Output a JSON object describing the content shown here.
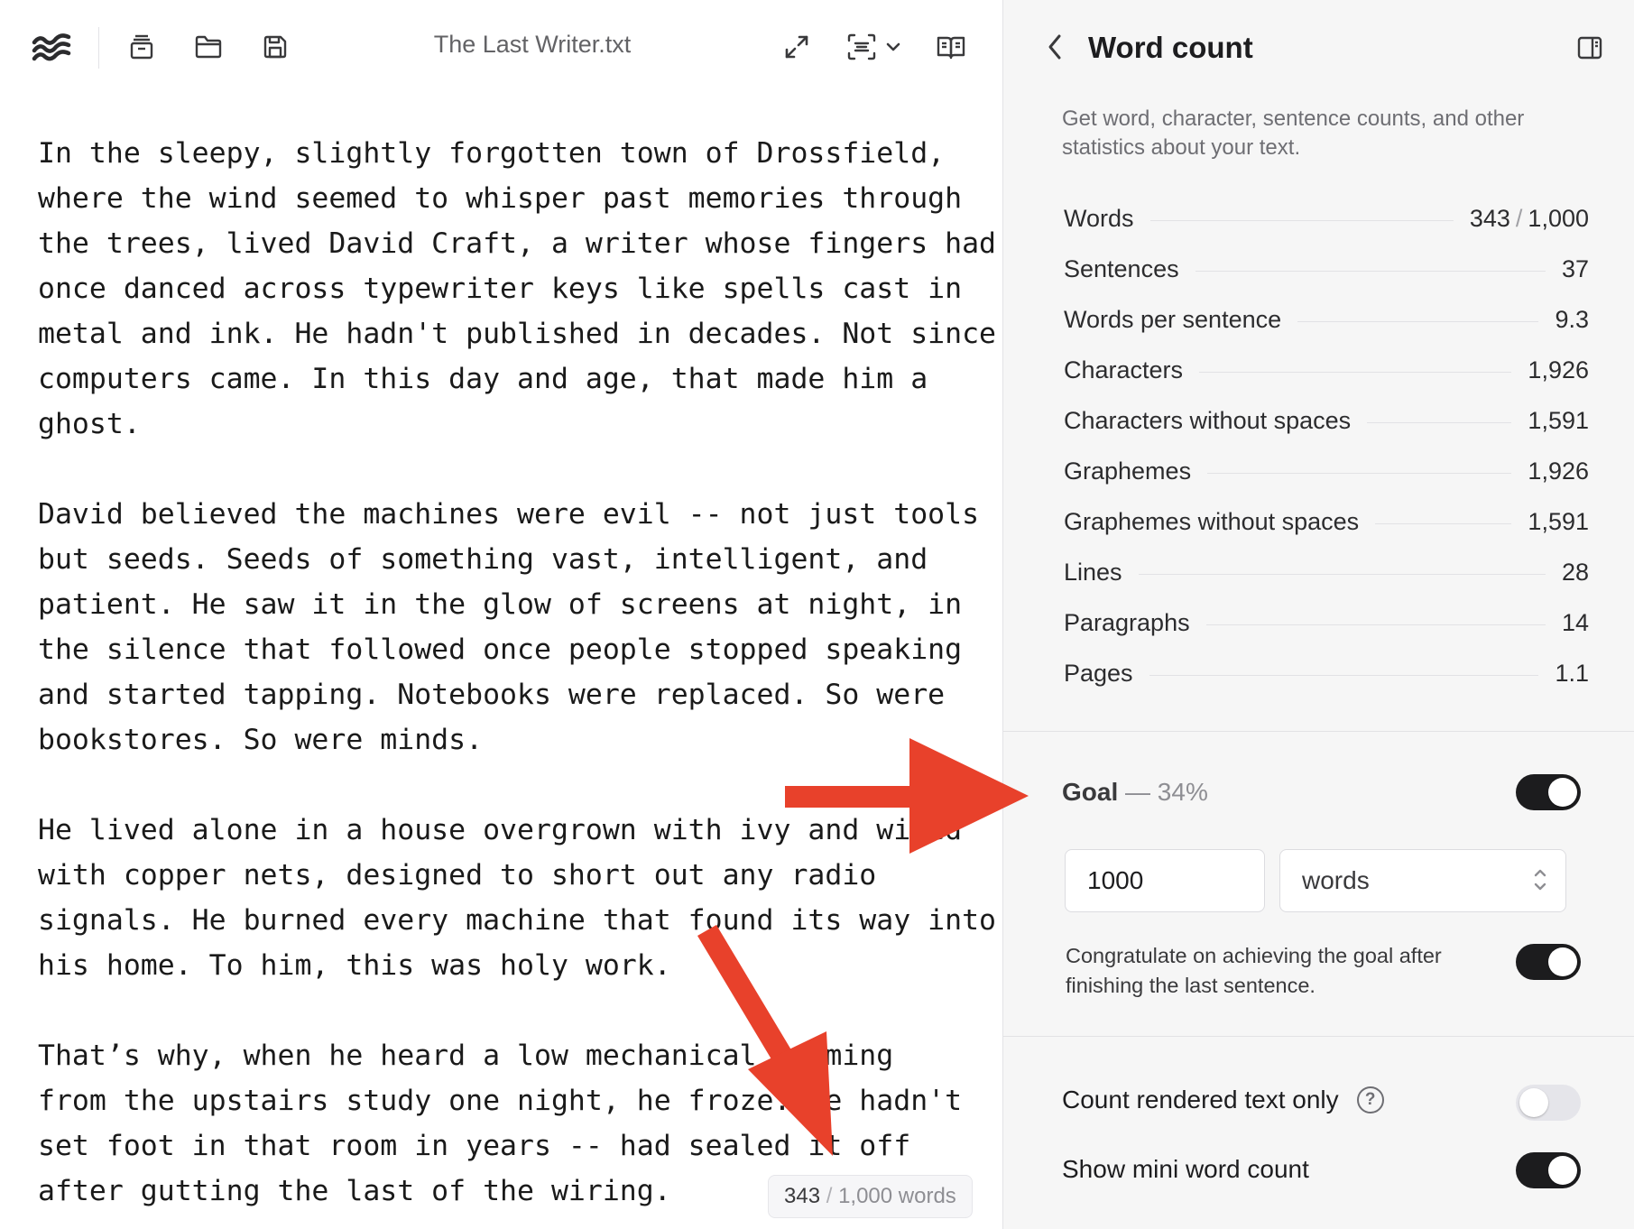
{
  "editor": {
    "document_title": "The Last Writer.txt",
    "toolbar": {
      "icons": [
        "waves-logo-icon",
        "archive-icon",
        "folder-icon",
        "save-icon",
        "expand-icon",
        "focus-scan-icon",
        "chevron-down-icon",
        "reader-book-icon"
      ]
    },
    "paragraphs": [
      [
        "In the sleepy, slightly forgotten town of Drossfield,",
        "where the wind seemed to whisper past memories through",
        "the trees, lived David Craft, a writer whose fingers had",
        "once danced across typewriter keys like spells cast in",
        "metal and ink. He hadn't published in decades. Not since",
        "computers came. In this day and age, that made him a",
        "ghost."
      ],
      [
        "David believed the machines were evil -- not just tools",
        "but seeds. Seeds of something vast, intelligent, and",
        "patient. He saw it in the glow of screens at night, in",
        "the silence that followed once people stopped speaking",
        "and started tapping. Notebooks were replaced. So were",
        "bookstores. So were minds."
      ],
      [
        "He lived alone in a house overgrown with ivy and wired",
        "with copper nets, designed to short out any radio",
        "signals. He burned every machine that found its way into",
        "his home. To him, this was holy work."
      ],
      [
        "That’s why, when he heard a low mechanical humming",
        "from the upstairs study one night, he froze. He hadn't",
        "set foot in that room in years -- had sealed it off",
        "after gutting the last of the wiring."
      ]
    ],
    "mini_word_count": {
      "current": "343",
      "separator": "/",
      "goal_text": "1,000 words"
    }
  },
  "sidebar": {
    "title": "Word count",
    "description": "Get word, character, sentence counts, and other statistics about your text.",
    "stats": [
      {
        "label": "Words",
        "value": "343",
        "goal": "1,000"
      },
      {
        "label": "Sentences",
        "value": "37"
      },
      {
        "label": "Words per sentence",
        "value": "9.3"
      },
      {
        "label": "Characters",
        "value": "1,926"
      },
      {
        "label": "Characters without spaces",
        "value": "1,591"
      },
      {
        "label": "Graphemes",
        "value": "1,926"
      },
      {
        "label": "Graphemes without spaces",
        "value": "1,591"
      },
      {
        "label": "Lines",
        "value": "28"
      },
      {
        "label": "Paragraphs",
        "value": "14"
      },
      {
        "label": "Pages",
        "value": "1.1"
      }
    ],
    "goal": {
      "label": "Goal",
      "dash": " — ",
      "percent": "34%",
      "enabled": true,
      "target_value": "1000",
      "unit": "words"
    },
    "congratulate": {
      "text": "Congratulate on achieving the goal after finishing the last sentence.",
      "enabled": true
    },
    "count_rendered_only": {
      "label": "Count rendered text only",
      "enabled": false
    },
    "show_mini_word_count": {
      "label": "Show mini word count",
      "enabled": true
    }
  },
  "colors": {
    "annotation_arrow": "#e8412b",
    "toggle_on": "#1c1c1e",
    "toggle_off": "#e5e5ea",
    "sidebar_bg": "#f6f6f6"
  }
}
